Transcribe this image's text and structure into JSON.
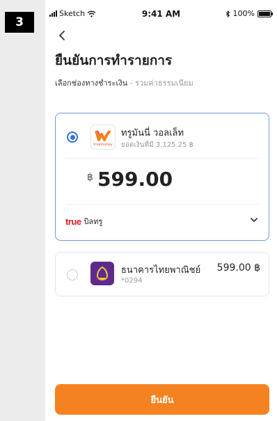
{
  "step_badge": "3",
  "status_bar": {
    "carrier": "Sketch",
    "time": "9:41 AM",
    "battery": "100%"
  },
  "header": {
    "title": "ยืนยันการทำรายการ",
    "subtitle": "เลือกช่องทางชำระเงิน",
    "subtitle_hint": " - รวมค่าธรรมเนียม"
  },
  "selected_method": {
    "name": "ทรูมันนี่ วอลเล็ท",
    "balance": "ยอดเงินที่มี 3,125.25 ฿",
    "logo_caption": "truemoney",
    "amount_currency": "฿",
    "amount": "599.00",
    "bill_logo": "true",
    "bill_label": "บิลทรู"
  },
  "other_method": {
    "name": "ธนาคารไทยพาณิชย์",
    "account": "*0294",
    "amount": "599.00 ฿"
  },
  "confirm_label": "ยืนยัน",
  "icons": {
    "back": "chevron-left-icon",
    "dropdown": "chevron-down-icon",
    "wallet": "truemoney-logo-icon",
    "bank": "scb-logo-icon"
  },
  "colors": {
    "accent_orange": "#f58220",
    "selection_blue": "#2f72d3",
    "bank_purple": "#5e2b8c",
    "true_red": "#e01b22"
  }
}
